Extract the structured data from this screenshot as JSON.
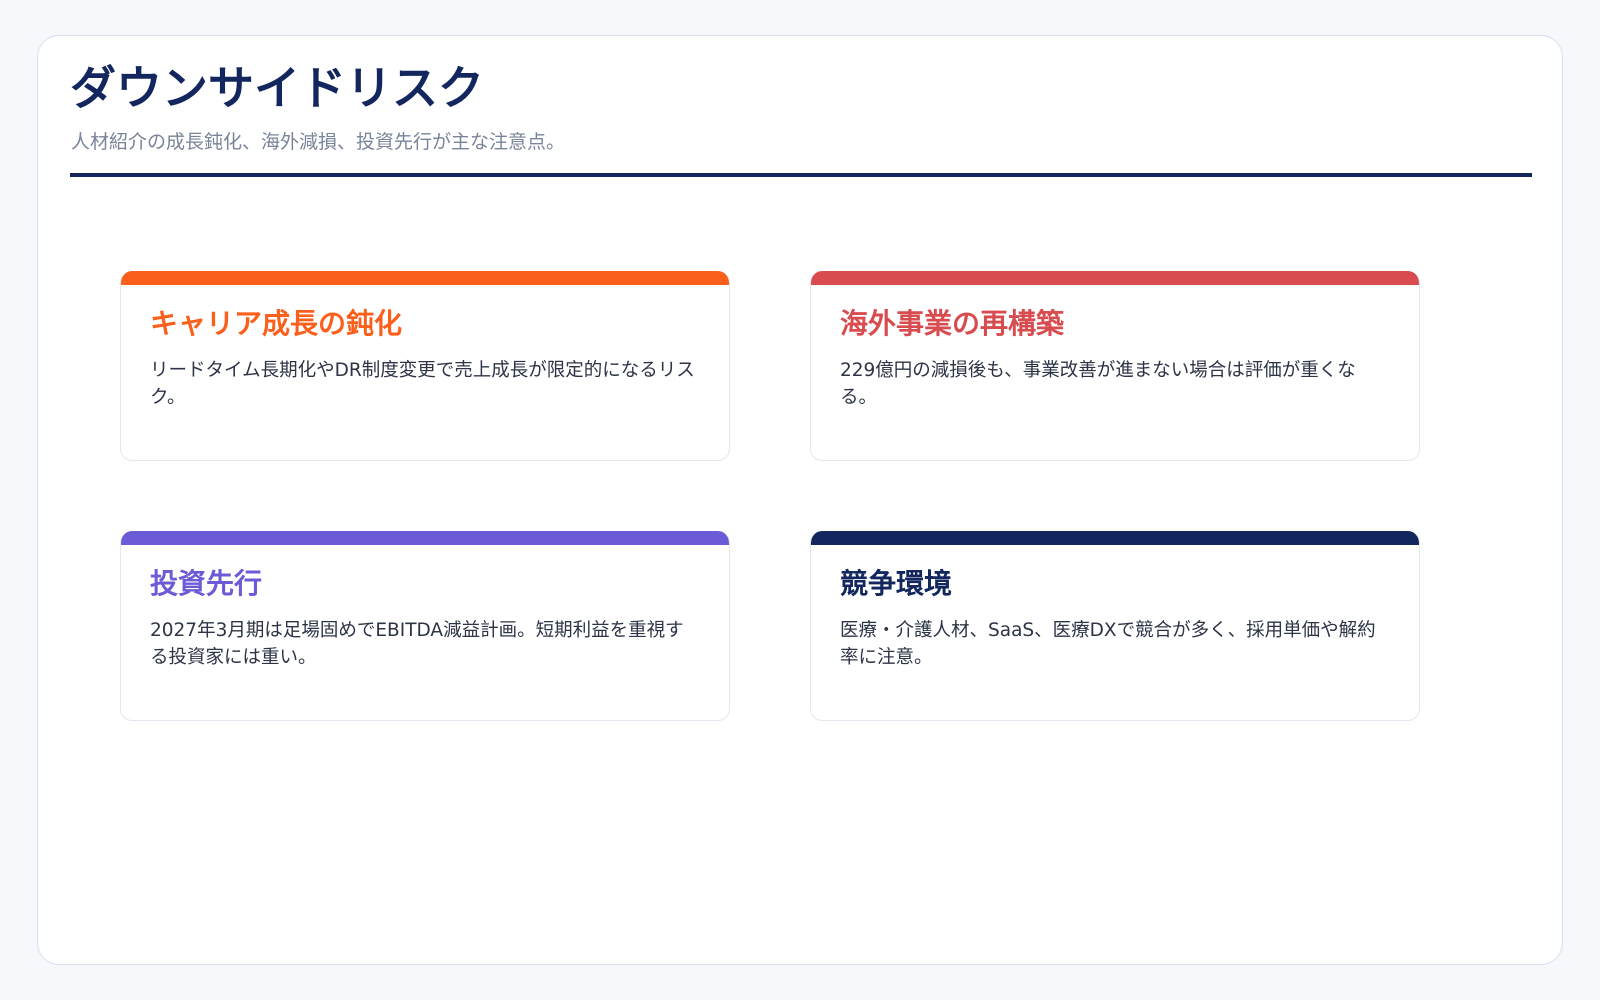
{
  "header": {
    "title": "ダウンサイドリスク",
    "subtitle": "人材紹介の成長鈍化、海外減損、投資先行が主な注意点。"
  },
  "cards": [
    {
      "title": "キャリア成長の鈍化",
      "body": "リードタイム長期化やDR制度変更で売上成長が限定的になるリスク。",
      "accent": "#fb5f1c"
    },
    {
      "title": "海外事業の再構築",
      "body": "229億円の減損後も、事業改善が進まない場合は評価が重くなる。",
      "accent": "#d84c4f"
    },
    {
      "title": "投資先行",
      "body": "2027年3月期は足場固めでEBITDA減益計画。短期利益を重視する投資家には重い。",
      "accent": "#6c5bd6"
    },
    {
      "title": "競争環境",
      "body": "医療・介護人材、SaaS、医療DXで競合が多く、採用単価や解約率に注意。",
      "accent": "#13275e"
    }
  ],
  "colors": {
    "page_background": "#f6f8fb",
    "panel_background": "#ffffff",
    "title": "#13275e",
    "subtitle": "#7a8499",
    "body_text": "#2c3446"
  }
}
